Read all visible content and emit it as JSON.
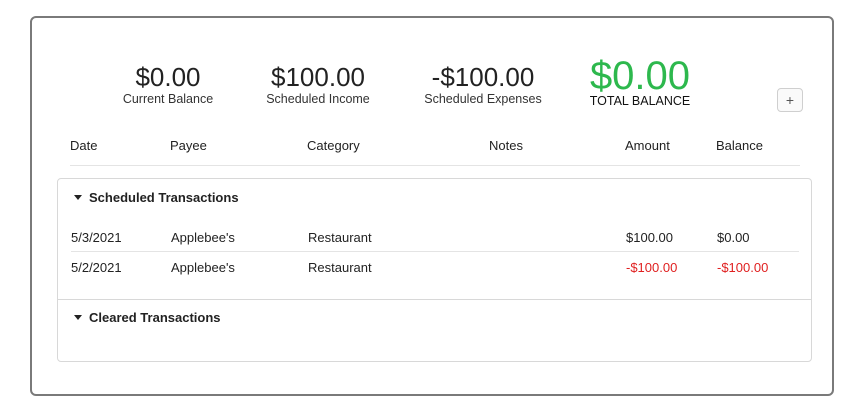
{
  "summary": {
    "current_balance": {
      "amount": "$0.00",
      "label": "Current Balance"
    },
    "scheduled_income": {
      "amount": "$100.00",
      "label": "Scheduled Income"
    },
    "scheduled_expenses": {
      "amount": "-$100.00",
      "label": "Scheduled Expenses"
    },
    "total_balance": {
      "amount": "$0.00",
      "label": "TOTAL BALANCE"
    }
  },
  "add_button": {
    "label": "+"
  },
  "columns": {
    "date": "Date",
    "payee": "Payee",
    "category": "Category",
    "notes": "Notes",
    "amount": "Amount",
    "balance": "Balance"
  },
  "sections": {
    "scheduled": {
      "title": "Scheduled Transactions"
    },
    "cleared": {
      "title": "Cleared Transactions"
    }
  },
  "scheduled_rows": [
    {
      "date": "5/3/2021",
      "payee": "Applebee's",
      "category": "Restaurant",
      "notes": "",
      "amount": "$100.00",
      "balance": "$0.00"
    },
    {
      "date": "5/2/2021",
      "payee": "Applebee's",
      "category": "Restaurant",
      "notes": "",
      "amount": "-$100.00",
      "balance": "-$100.00"
    }
  ],
  "colors": {
    "total_balance": "#2db84d",
    "negative": "#e02020"
  }
}
